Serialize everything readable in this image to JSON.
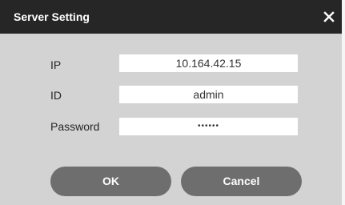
{
  "dialog": {
    "title": "Server Setting",
    "close_icon": "close-icon",
    "fields": {
      "ip": {
        "label": "IP",
        "value": "10.164.42.15"
      },
      "id": {
        "label": "ID",
        "value": "admin"
      },
      "password": {
        "label": "Password",
        "value": "••••••"
      }
    },
    "buttons": {
      "ok_label": "OK",
      "cancel_label": "Cancel"
    }
  },
  "colors": {
    "titlebar": "#262626",
    "body": "#d3d3d3",
    "button": "#6e6e6e",
    "field": "#ffffff"
  }
}
